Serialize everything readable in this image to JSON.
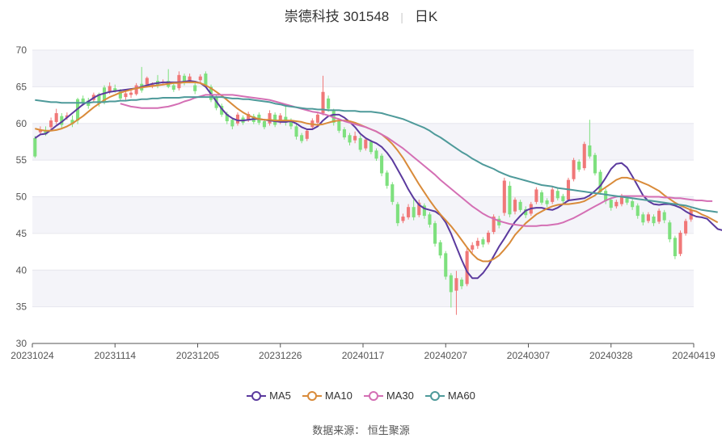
{
  "header": {
    "stock": "崇德科技 301548",
    "period": "日K"
  },
  "source": "数据来源： 恒生聚源",
  "colors": {
    "up": "#f07878",
    "down": "#7ee07e",
    "MA5": "#5b3a9e",
    "MA10": "#d98b3a",
    "MA30": "#d46fb4",
    "MA60": "#4e9a9a"
  },
  "chart_data": {
    "type": "candlestick",
    "xlabel": "",
    "ylabel": "",
    "ylim": [
      30,
      70
    ],
    "yticks": [
      30,
      35,
      40,
      45,
      50,
      55,
      60,
      65,
      70
    ],
    "xtick_labels": [
      "20231024",
      "20231114",
      "20231205",
      "20231226",
      "20240117",
      "20240207",
      "20240307",
      "20240328",
      "20240419"
    ],
    "grid": "horizontal bands",
    "legend": "bottom-center",
    "candles": [
      [
        58.0,
        55.5,
        58.3,
        55.3
      ],
      [
        58.8,
        59.2,
        59.6,
        58.4
      ],
      [
        59.1,
        58.5,
        59.6,
        58.3
      ],
      [
        59.5,
        60.4,
        60.8,
        59.2
      ],
      [
        60.2,
        61.4,
        62.0,
        59.9
      ],
      [
        61.0,
        59.8,
        61.4,
        59.2
      ],
      [
        60.8,
        61.1,
        61.5,
        60.5
      ],
      [
        60.5,
        59.9,
        61.1,
        59.5
      ],
      [
        63.3,
        60.4,
        63.5,
        59.9
      ],
      [
        63.4,
        62.8,
        63.8,
        62.4
      ],
      [
        63.1,
        62.4,
        63.5,
        62.0
      ],
      [
        63.2,
        63.9,
        64.2,
        62.9
      ],
      [
        64.0,
        62.7,
        64.2,
        62.3
      ],
      [
        64.9,
        62.9,
        65.2,
        62.6
      ],
      [
        64.3,
        65.1,
        65.6,
        64.0
      ],
      [
        64.8,
        64.5,
        65.3,
        64.2
      ],
      [
        64.4,
        63.4,
        64.7,
        63.1
      ],
      [
        63.6,
        64.1,
        64.5,
        63.2
      ],
      [
        63.9,
        64.2,
        64.8,
        63.5
      ],
      [
        64.0,
        65.2,
        65.5,
        63.8
      ],
      [
        65.4,
        64.5,
        67.7,
        64.2
      ],
      [
        65.3,
        66.2,
        66.4,
        65.0
      ],
      [
        65.1,
        65.3,
        65.6,
        64.8
      ],
      [
        65.8,
        65.1,
        66.6,
        64.8
      ],
      [
        65.5,
        65.7,
        66.0,
        65.2
      ],
      [
        65.8,
        65.0,
        67.4,
        64.8
      ],
      [
        65.2,
        64.6,
        65.5,
        64.3
      ],
      [
        64.8,
        66.6,
        67.1,
        64.5
      ],
      [
        66.5,
        65.5,
        66.8,
        65.2
      ],
      [
        65.8,
        66.4,
        66.8,
        65.5
      ],
      [
        65.2,
        64.4,
        65.5,
        64.0
      ],
      [
        65.9,
        66.4,
        66.7,
        65.6
      ],
      [
        66.8,
        65.2,
        67.1,
        64.9
      ],
      [
        65.0,
        63.2,
        65.3,
        62.9
      ],
      [
        63.6,
        62.1,
        63.9,
        61.8
      ],
      [
        62.4,
        61.2,
        62.7,
        60.9
      ],
      [
        61.3,
        60.3,
        61.6,
        59.9
      ],
      [
        60.5,
        59.6,
        60.8,
        59.2
      ],
      [
        60.0,
        61.2,
        61.5,
        59.7
      ],
      [
        60.8,
        60.1,
        61.1,
        59.8
      ],
      [
        60.5,
        61.3,
        61.6,
        60.2
      ],
      [
        61.0,
        60.2,
        61.3,
        59.9
      ],
      [
        61.2,
        60.1,
        61.5,
        59.8
      ],
      [
        60.3,
        59.5,
        60.6,
        59.2
      ],
      [
        60.0,
        61.4,
        61.8,
        59.7
      ],
      [
        61.2,
        59.8,
        61.5,
        59.5
      ],
      [
        60.2,
        61.1,
        61.4,
        59.9
      ],
      [
        60.9,
        60.1,
        62.3,
        59.7
      ],
      [
        60.4,
        59.6,
        60.7,
        59.2
      ],
      [
        59.6,
        58.2,
        59.9,
        57.8
      ],
      [
        58.4,
        57.6,
        58.7,
        57.3
      ],
      [
        57.9,
        59.0,
        59.3,
        57.6
      ],
      [
        59.5,
        60.4,
        60.7,
        59.2
      ],
      [
        60.1,
        61.2,
        61.5,
        59.8
      ],
      [
        61.4,
        64.3,
        66.5,
        61.1
      ],
      [
        63.4,
        62.0,
        63.8,
        61.6
      ],
      [
        61.7,
        60.1,
        62.0,
        59.7
      ],
      [
        60.3,
        59.0,
        60.6,
        58.7
      ],
      [
        59.2,
        58.1,
        59.5,
        57.8
      ],
      [
        58.4,
        57.4,
        58.7,
        57.0
      ],
      [
        57.7,
        58.3,
        58.9,
        57.3
      ],
      [
        58.0,
        56.4,
        58.4,
        56.1
      ],
      [
        56.6,
        57.8,
        58.1,
        56.3
      ],
      [
        57.5,
        56.1,
        57.8,
        55.8
      ],
      [
        56.3,
        55.2,
        56.6,
        54.9
      ],
      [
        55.6,
        53.2,
        55.9,
        52.8
      ],
      [
        53.3,
        51.5,
        53.6,
        51.1
      ],
      [
        51.7,
        49.3,
        52.0,
        48.9
      ],
      [
        49.0,
        46.4,
        49.3,
        46.0
      ],
      [
        46.7,
        47.3,
        47.7,
        46.4
      ],
      [
        47.2,
        48.6,
        49.0,
        46.9
      ],
      [
        48.6,
        47.2,
        49.6,
        46.8
      ],
      [
        47.5,
        49.2,
        49.6,
        47.2
      ],
      [
        48.8,
        47.4,
        49.1,
        47.0
      ],
      [
        47.6,
        46.2,
        47.9,
        45.8
      ],
      [
        46.4,
        43.6,
        46.7,
        43.2
      ],
      [
        43.8,
        42.0,
        44.1,
        41.6
      ],
      [
        42.3,
        39.1,
        42.6,
        38.7
      ],
      [
        39.3,
        37.0,
        39.6,
        34.9
      ],
      [
        37.2,
        38.9,
        39.9,
        33.9
      ],
      [
        38.7,
        37.8,
        39.0,
        37.4
      ],
      [
        38.1,
        42.6,
        43.0,
        37.8
      ],
      [
        42.8,
        43.4,
        43.8,
        42.4
      ],
      [
        43.3,
        44.0,
        44.4,
        42.9
      ],
      [
        44.2,
        43.5,
        44.5,
        43.1
      ],
      [
        43.8,
        45.1,
        45.4,
        43.5
      ],
      [
        45.2,
        47.3,
        47.6,
        44.9
      ],
      [
        47.0,
        46.1,
        47.4,
        45.7
      ],
      [
        47.8,
        52.2,
        52.6,
        47.4
      ],
      [
        51.5,
        47.6,
        52.1,
        47.2
      ],
      [
        48.0,
        49.6,
        49.9,
        47.6
      ],
      [
        49.3,
        48.2,
        49.6,
        47.9
      ],
      [
        48.3,
        47.5,
        48.7,
        47.1
      ],
      [
        47.7,
        49.0,
        49.3,
        47.4
      ],
      [
        49.3,
        51.0,
        51.3,
        49.0
      ],
      [
        50.6,
        49.2,
        50.9,
        48.9
      ],
      [
        49.5,
        49.0,
        49.8,
        48.6
      ],
      [
        49.3,
        51.0,
        51.3,
        49.0
      ],
      [
        50.8,
        49.8,
        51.1,
        49.5
      ],
      [
        50.1,
        49.4,
        50.4,
        49.1
      ],
      [
        49.6,
        52.3,
        52.6,
        49.3
      ],
      [
        52.4,
        55.0,
        55.3,
        52.1
      ],
      [
        54.8,
        53.7,
        55.1,
        53.4
      ],
      [
        53.9,
        57.2,
        57.5,
        53.6
      ],
      [
        57.0,
        55.5,
        60.5,
        55.2
      ],
      [
        55.7,
        53.2,
        56.0,
        52.9
      ],
      [
        53.4,
        50.6,
        53.7,
        50.3
      ],
      [
        50.8,
        49.4,
        51.1,
        49.0
      ],
      [
        49.6,
        48.5,
        49.9,
        48.1
      ],
      [
        48.7,
        49.3,
        49.6,
        48.4
      ],
      [
        49.0,
        50.1,
        50.4,
        48.7
      ],
      [
        49.8,
        49.2,
        50.1,
        48.9
      ],
      [
        49.4,
        48.6,
        49.7,
        48.2
      ],
      [
        48.8,
        47.4,
        49.1,
        47.0
      ],
      [
        47.6,
        46.5,
        47.9,
        46.1
      ],
      [
        46.7,
        47.6,
        47.9,
        46.4
      ],
      [
        47.3,
        46.4,
        47.6,
        46.0
      ],
      [
        46.6,
        48.1,
        48.4,
        46.3
      ],
      [
        47.9,
        46.8,
        48.2,
        46.4
      ],
      [
        46.5,
        44.2,
        46.8,
        43.8
      ],
      [
        44.4,
        41.9,
        44.7,
        41.5
      ],
      [
        42.2,
        45.1,
        45.4,
        41.9
      ],
      [
        45.0,
        46.7,
        47.0,
        44.7
      ],
      [
        46.9,
        48.2,
        48.5,
        46.6
      ]
    ],
    "series": [
      {
        "name": "MA5",
        "values": [
          58.0,
          58.5,
          58.6,
          59.1,
          59.7,
          60.2,
          60.8,
          61.4,
          62.0,
          62.6,
          63.0,
          63.5,
          63.9,
          64.1,
          64.3,
          64.4,
          64.5,
          64.6,
          64.7,
          64.8,
          65.0,
          65.2,
          65.4,
          65.5,
          65.6,
          65.6,
          65.6,
          65.6,
          65.7,
          65.8,
          65.7,
          65.5,
          65.0,
          64.0,
          63.0,
          62.0,
          61.2,
          60.7,
          60.4,
          60.4,
          60.5,
          60.6,
          60.6,
          60.5,
          60.4,
          60.3,
          60.2,
          60.2,
          60.3,
          60.0,
          59.5,
          59.2,
          59.2,
          59.6,
          60.4,
          61.0,
          61.2,
          61.2,
          60.8,
          60.2,
          59.5,
          58.6,
          58.0,
          57.6,
          57.3,
          56.8,
          56.0,
          55.0,
          53.7,
          52.4,
          51.0,
          49.8,
          48.9,
          48.4,
          48.2,
          48.0,
          47.5,
          46.5,
          45.0,
          43.2,
          41.4,
          39.8,
          38.9,
          38.9,
          39.6,
          40.6,
          41.9,
          43.2,
          44.3,
          45.5,
          46.6,
          47.4,
          48.1,
          48.4,
          48.5,
          48.5,
          48.3,
          48.2,
          48.5,
          49.0,
          49.5,
          49.6,
          49.7,
          49.8,
          50.2,
          50.8,
          51.5,
          52.6,
          53.8,
          54.5,
          54.6,
          54.0,
          52.8,
          51.5,
          50.2,
          49.4,
          49.0,
          48.9,
          49.0,
          49.0,
          48.8,
          48.5,
          48.0,
          47.6,
          47.3,
          47.2,
          47.0,
          46.3,
          45.6,
          45.4,
          45.7
        ]
      },
      {
        "name": "MA10",
        "values": [
          59.3,
          59.1,
          59.0,
          59.0,
          59.1,
          59.3,
          59.6,
          60.0,
          60.5,
          61.0,
          61.6,
          62.2,
          62.7,
          63.2,
          63.6,
          63.9,
          64.2,
          64.4,
          64.6,
          64.8,
          64.9,
          65.0,
          65.1,
          65.2,
          65.3,
          65.4,
          65.5,
          65.5,
          65.6,
          65.6,
          65.6,
          65.5,
          65.2,
          64.8,
          64.3,
          63.8,
          63.2,
          62.6,
          62.0,
          61.5,
          61.1,
          60.8,
          60.6,
          60.5,
          60.5,
          60.4,
          60.4,
          60.4,
          60.4,
          60.3,
          60.2,
          60.0,
          59.9,
          59.8,
          59.9,
          60.1,
          60.3,
          60.4,
          60.4,
          60.3,
          60.1,
          59.8,
          59.5,
          59.2,
          58.9,
          58.5,
          57.9,
          57.2,
          56.3,
          55.3,
          54.1,
          52.9,
          51.7,
          50.6,
          49.5,
          48.5,
          47.6,
          46.8,
          46.0,
          45.1,
          44.1,
          43.1,
          42.2,
          41.5,
          41.2,
          41.2,
          41.5,
          42.0,
          42.8,
          43.7,
          44.8,
          45.6,
          46.4,
          47.0,
          47.6,
          48.0,
          48.4,
          48.7,
          48.9,
          49.0,
          49.0,
          49.1,
          49.2,
          49.4,
          49.8,
          50.2,
          50.8,
          51.3,
          51.8,
          52.3,
          52.6,
          52.6,
          52.4,
          52.2,
          51.9,
          51.6,
          51.2,
          50.8,
          50.2,
          49.7,
          49.2,
          48.8,
          48.5,
          48.2,
          48.0,
          47.6,
          47.3,
          46.9,
          46.5
        ]
      },
      {
        "name": "MA30",
        "values": [
          null,
          null,
          null,
          null,
          null,
          null,
          null,
          null,
          null,
          null,
          null,
          null,
          null,
          null,
          null,
          null,
          62.7,
          62.5,
          62.3,
          62.2,
          62.1,
          62.1,
          62.1,
          62.1,
          62.2,
          62.3,
          62.5,
          62.7,
          63.0,
          63.2,
          63.5,
          63.7,
          63.9,
          63.9,
          63.9,
          63.9,
          63.9,
          63.9,
          63.8,
          63.7,
          63.6,
          63.5,
          63.4,
          63.3,
          63.2,
          63.0,
          62.8,
          62.6,
          62.4,
          62.2,
          62.0,
          61.8,
          61.6,
          61.5,
          61.3,
          61.1,
          60.8,
          60.6,
          60.3,
          60.1,
          59.9,
          59.7,
          59.5,
          59.2,
          58.9,
          58.5,
          58.1,
          57.6,
          57.1,
          56.6,
          56.0,
          55.4,
          54.8,
          54.2,
          53.6,
          53.0,
          52.3,
          51.7,
          51.1,
          50.5,
          49.9,
          49.3,
          48.7,
          48.2,
          47.7,
          47.3,
          47.0,
          46.7,
          46.5,
          46.3,
          46.2,
          46.1,
          46.0,
          46.0,
          46.0,
          46.1,
          46.1,
          46.2,
          46.3,
          46.5,
          46.8,
          47.1,
          47.5,
          47.9,
          48.3,
          48.7,
          49.1,
          49.5,
          49.8,
          50.0,
          50.1,
          50.1,
          50.1,
          50.1,
          50.1,
          50.0,
          50.0,
          50.0,
          49.9,
          49.9,
          49.8,
          49.8,
          49.7,
          49.6,
          49.5,
          49.5,
          49.4,
          49.4
        ]
      },
      {
        "name": "MA60",
        "values": [
          63.2,
          63.1,
          63.0,
          62.9,
          62.9,
          62.8,
          62.8,
          62.8,
          62.8,
          62.8,
          62.8,
          62.9,
          62.9,
          62.9,
          63.0,
          63.0,
          63.1,
          63.1,
          63.2,
          63.2,
          63.3,
          63.3,
          63.4,
          63.4,
          63.5,
          63.5,
          63.5,
          63.5,
          63.6,
          63.6,
          63.6,
          63.6,
          63.6,
          63.6,
          63.6,
          63.6,
          63.5,
          63.4,
          63.4,
          63.3,
          63.3,
          63.2,
          63.1,
          63.0,
          62.9,
          62.7,
          62.6,
          62.4,
          62.3,
          62.2,
          62.1,
          62.0,
          62.0,
          61.9,
          61.9,
          61.8,
          61.8,
          61.8,
          61.7,
          61.7,
          61.7,
          61.6,
          61.6,
          61.6,
          61.5,
          61.4,
          61.2,
          61.0,
          60.8,
          60.6,
          60.3,
          60.0,
          59.7,
          59.4,
          59.0,
          58.5,
          58.1,
          57.6,
          57.1,
          56.6,
          56.1,
          55.7,
          55.2,
          54.8,
          54.4,
          54.1,
          53.8,
          53.4,
          53.1,
          52.8,
          52.6,
          52.4,
          52.2,
          52.0,
          51.8,
          51.6,
          51.5,
          51.4,
          51.2,
          51.1,
          51.0,
          50.9,
          50.8,
          50.7,
          50.6,
          50.5,
          50.4,
          50.3,
          50.2,
          50.1,
          50.0,
          49.9,
          49.8,
          49.7,
          49.6,
          49.5,
          49.4,
          49.3,
          49.2,
          49.1,
          49.0,
          48.9,
          48.8,
          48.6,
          48.4,
          48.2,
          48.1,
          48.0,
          47.9
        ]
      }
    ]
  }
}
